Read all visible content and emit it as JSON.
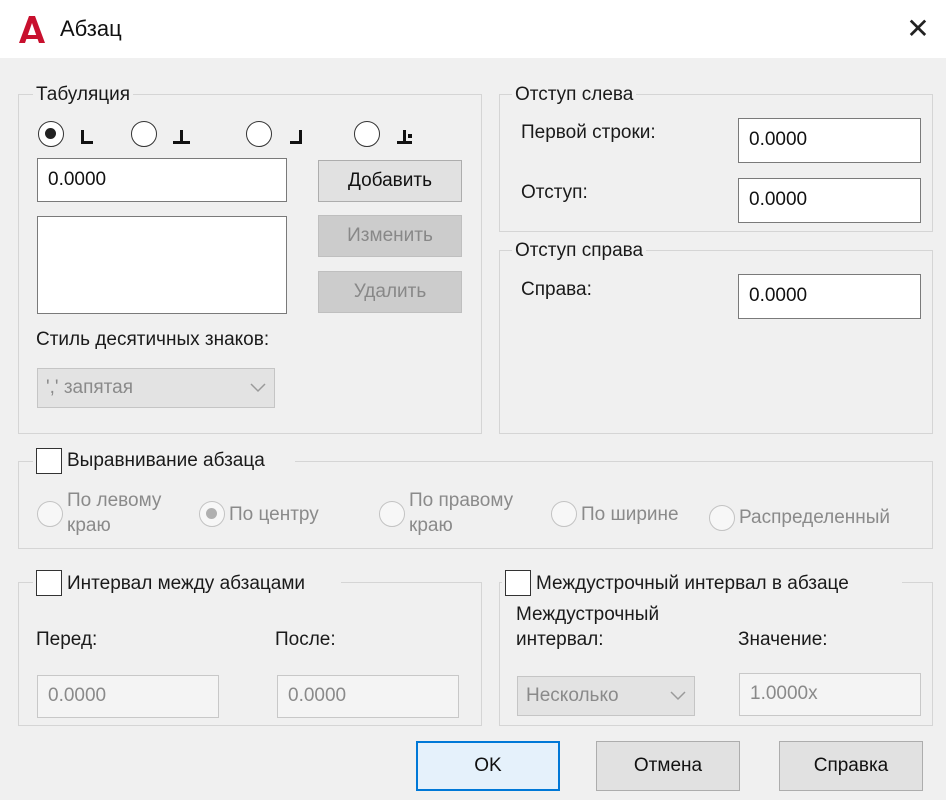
{
  "window": {
    "title": "Абзац",
    "app_logo_letter": "A",
    "accent_color": "#c8102e"
  },
  "tabs_section": {
    "legend": "Табуляция",
    "tab_types": [
      {
        "icon": "tab-left-icon",
        "checked": true
      },
      {
        "icon": "tab-center-icon",
        "checked": false
      },
      {
        "icon": "tab-right-icon",
        "checked": false
      },
      {
        "icon": "tab-decimal-icon",
        "checked": false
      }
    ],
    "position_value": "0.0000",
    "add_label": "Добавить",
    "modify_label": "Изменить",
    "delete_label": "Удалить",
    "decimal_style_label": "Стиль десятичных знаков:",
    "decimal_style_value": "',' запятая"
  },
  "left_indent": {
    "legend": "Отступ слева",
    "first_line_label": "Первой строки:",
    "first_line_value": "0.0000",
    "hanging_label": "Отступ:",
    "hanging_value": "0.0000"
  },
  "right_indent": {
    "legend": "Отступ справа",
    "right_label": "Справа:",
    "right_value": "0.0000"
  },
  "alignment": {
    "legend": "Выравнивание абзаца",
    "options": [
      {
        "line1": "По левому",
        "line2": "краю"
      },
      {
        "line1": "По центру",
        "line2": ""
      },
      {
        "line1": "По правому",
        "line2": "краю"
      },
      {
        "line1": "По ширине",
        "line2": ""
      },
      {
        "line1": "Распределенный",
        "line2": ""
      }
    ],
    "selected_index": 1
  },
  "paragraph_spacing": {
    "legend": "Интервал между абзацами",
    "before_label": "Перед:",
    "before_value": "0.0000",
    "after_label": "После:",
    "after_value": "0.0000"
  },
  "line_spacing": {
    "legend": "Междустрочный интервал в абзаце",
    "type_label_line1": "Междустрочный",
    "type_label_line2": "интервал:",
    "type_value": "Несколько",
    "value_label": "Значение:",
    "value": "1.0000x"
  },
  "footer": {
    "ok_label": "OK",
    "cancel_label": "Отмена",
    "help_label": "Справка"
  }
}
